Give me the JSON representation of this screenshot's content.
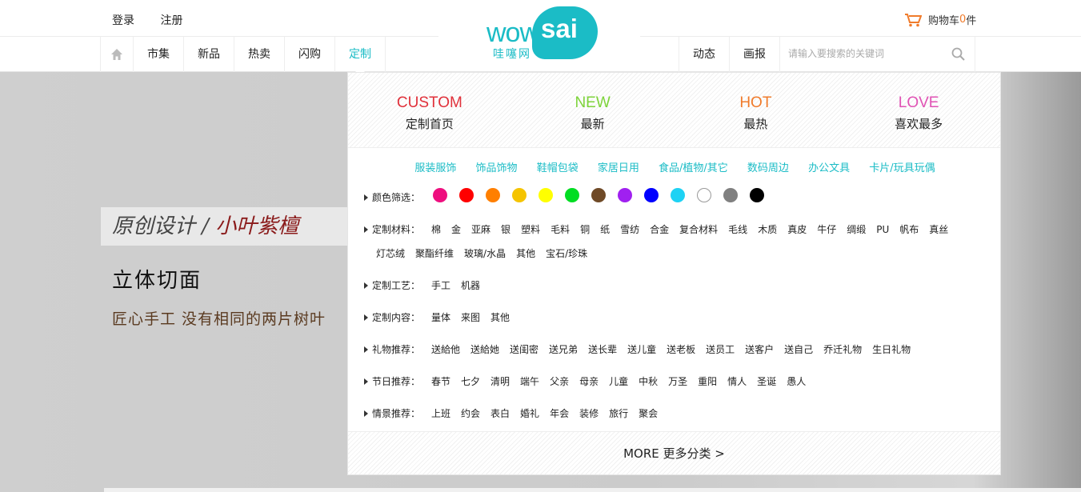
{
  "auth": {
    "login": "登录",
    "register": "注册"
  },
  "cart": {
    "label": "购物车",
    "count": "0",
    "unit": "件"
  },
  "logo": {
    "word": "wow",
    "bubble": "sai",
    "sub": "哇噻网"
  },
  "nav_left": [
    "市集",
    "新品",
    "热卖",
    "闪购",
    "定制"
  ],
  "nav_right": [
    "动态",
    "画报"
  ],
  "search": {
    "placeholder": "请输入要搜索的关键词"
  },
  "banner": {
    "handwriting_a": "原创设计 / ",
    "handwriting_b": "小叶紫檀",
    "title": "立体切面",
    "subtitle": "匠心手工 没有相同的两片树叶"
  },
  "dropdown": {
    "top": [
      {
        "en": "CUSTOM",
        "cn": "定制首页",
        "color": "#e0303a"
      },
      {
        "en": "NEW",
        "cn": "最新",
        "color": "#7dd33a"
      },
      {
        "en": "HOT",
        "cn": "最热",
        "color": "#f07b2b"
      },
      {
        "en": "LOVE",
        "cn": "喜欢最多",
        "color": "#e052b4"
      }
    ],
    "links": [
      "服装服饰",
      "饰品饰物",
      "鞋帽包袋",
      "家居日用",
      "食品/植物/其它",
      "数码周边",
      "办公文具",
      "卡片/玩具玩偶"
    ],
    "color_label": "颜色筛选：",
    "colors": [
      "#ee0f7f",
      "#ff0000",
      "#ff7f00",
      "#f5c400",
      "#ffff00",
      "#00dd22",
      "#6f4a27",
      "#a020f0",
      "#0000ff",
      "#1ed2f4",
      "#ffffff",
      "#808080",
      "#000000"
    ],
    "material": {
      "label": "定制材料：",
      "line1": [
        "棉",
        "金",
        "亚麻",
        "银",
        "塑料",
        "毛料",
        "铜",
        "纸",
        "雪纺",
        "合金",
        "复合材料",
        "毛线",
        "木质",
        "真皮",
        "牛仔",
        "绸缎",
        "PU",
        "帆布",
        "真丝"
      ],
      "line2": [
        "灯芯绒",
        "聚酯纤维",
        "玻璃/水晶",
        "其他",
        "宝石/珍珠"
      ]
    },
    "craft": {
      "label": "定制工艺：",
      "tags": [
        "手工",
        "机器"
      ]
    },
    "content": {
      "label": "定制内容：",
      "tags": [
        "量体",
        "来图",
        "其他"
      ]
    },
    "gift": {
      "label": "礼物推荐：",
      "tags": [
        "送給他",
        "送給她",
        "送闺密",
        "送兄弟",
        "送长辈",
        "送儿童",
        "送老板",
        "送员工",
        "送客户",
        "送自己",
        "乔迁礼物",
        "生日礼物"
      ]
    },
    "festival": {
      "label": "节日推荐：",
      "tags": [
        "春节",
        "七夕",
        "清明",
        "端午",
        "父亲",
        "母亲",
        "儿童",
        "中秋",
        "万圣",
        "重阳",
        "情人",
        "圣诞",
        "愚人"
      ]
    },
    "scene": {
      "label": "情景推荐：",
      "tags": [
        "上班",
        "约会",
        "表白",
        "婚礼",
        "年会",
        "装修",
        "旅行",
        "聚会"
      ]
    },
    "more": "MORE 更多分类 >"
  }
}
